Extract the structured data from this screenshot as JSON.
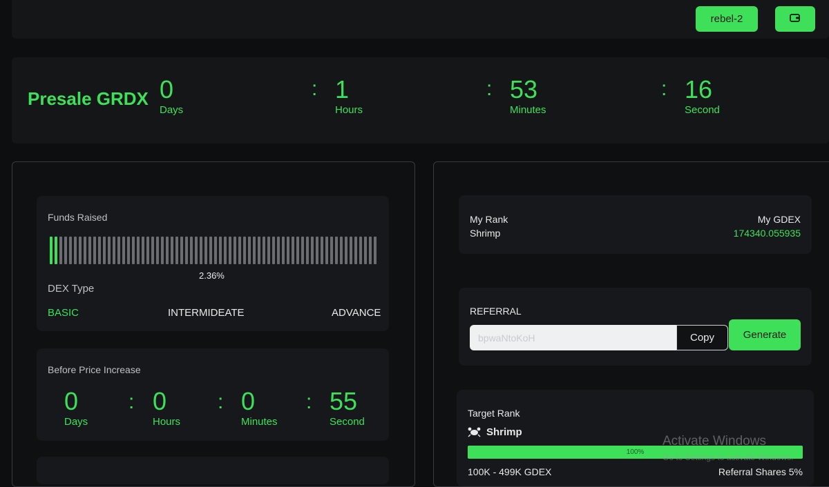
{
  "header": {
    "wallet_label": "rebel-2",
    "wallet_icon": "wallet-icon"
  },
  "presale": {
    "title": "Presale GRDX",
    "countdown": [
      {
        "value": "0",
        "label": "Days"
      },
      {
        "value": "1",
        "label": "Hours"
      },
      {
        "value": "53",
        "label": "Minutes"
      },
      {
        "value": "16",
        "label": "Second"
      }
    ],
    "separator": ":"
  },
  "funds": {
    "label": "Funds Raised",
    "percent_text": "2.36%",
    "percent_value": 2.36,
    "dex_type_label": "DEX Type",
    "tiers": [
      "BASIC",
      "INTERMIDEATE",
      "ADVANCE"
    ]
  },
  "price_increase": {
    "label": "Before Price Increase",
    "countdown": [
      {
        "value": "0",
        "label": "Days"
      },
      {
        "value": "0",
        "label": "Hours"
      },
      {
        "value": "0",
        "label": "Minutes"
      },
      {
        "value": "55",
        "label": "Second"
      }
    ]
  },
  "rank": {
    "my_rank_label": "My Rank",
    "my_rank_value": "Shrimp",
    "my_gdex_label": "My GDEX",
    "my_gdex_value": "174340.055935"
  },
  "referral": {
    "label": "REFERRAL",
    "code": "bpwaNtoKoH",
    "copy_label": "Copy",
    "generate_label": "Generate"
  },
  "target": {
    "label": "Target Rank",
    "rank_icon": "crab-icon",
    "rank_name": "Shrimp",
    "progress_text": "100%",
    "progress_value": 100,
    "range_text": "100K - 499K GDEX",
    "shares_text": "Referral Shares 5%"
  },
  "watermark": {
    "line1": "Activate Windows",
    "line2": "Go to Settings to activate Windows."
  },
  "colors": {
    "accent": "#3ee05a",
    "background": "#0d0e10",
    "card": "#17181b"
  }
}
